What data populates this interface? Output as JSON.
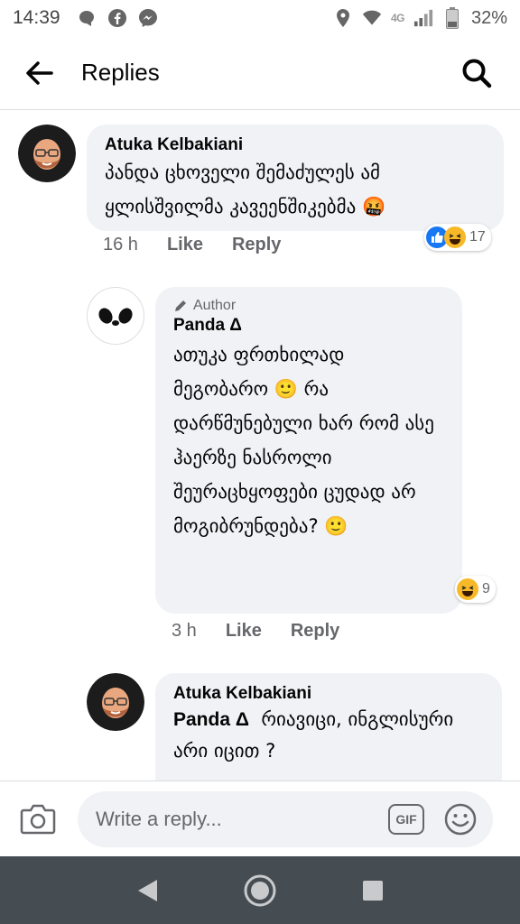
{
  "status_bar": {
    "time": "14:39",
    "network": "4G",
    "battery": "32%",
    "icons": [
      "chat-icon",
      "facebook-icon",
      "messenger-icon",
      "location-icon",
      "wifi-icon",
      "signal-icon",
      "battery-icon"
    ]
  },
  "header": {
    "title": "Replies",
    "back_icon": "arrow-left-icon",
    "search_icon": "search-icon"
  },
  "comments": [
    {
      "author": "Atuka Kelbakiani",
      "text": "პანდა ცხოველი შემაძულეს ამ ყლისშვილმა კავეენშიკებმა 🤬",
      "time": "16 h",
      "like_label": "Like",
      "reply_label": "Reply",
      "reactions": [
        "like",
        "haha"
      ],
      "reaction_count": "17"
    },
    {
      "badge": "Author",
      "author": "Panda Δ",
      "text": "ათუკა ფრთხილად მეგობარო 🙂 რა დარწმუნებული ხარ რომ  ასე ჰაერზე ნასროლი შეურაცხყოფები ცუდად არ მოგიბრუნდება? 🙂",
      "time": "3 h",
      "like_label": "Like",
      "reply_label": "Reply",
      "reactions": [
        "haha"
      ],
      "reaction_count": "9"
    },
    {
      "author": "Atuka Kelbakiani",
      "mention": "Panda Δ",
      "text": "რიავიცი, ინგლისური არი იცით ?"
    }
  ],
  "composer": {
    "placeholder": "Write a reply...",
    "gif_label": "GIF"
  },
  "colors": {
    "bubble": "#f0f2f5",
    "like_blue": "#1877f2",
    "haha_yellow": "#f7b928",
    "nav_bg": "#464d52",
    "secondary_text": "#65676b"
  }
}
